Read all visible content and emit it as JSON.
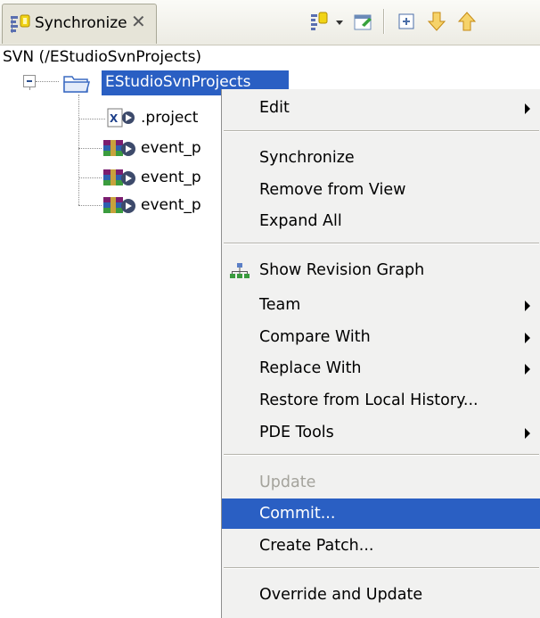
{
  "view": {
    "tab_label": "Synchronize",
    "close_glyph": "✕",
    "tab_icon": "synchronize-view-icon",
    "toolbar_icons": [
      "synchronize-dropdown-icon",
      "pin-icon",
      "expand-all-icon",
      "next-change-icon",
      "previous-change-icon"
    ]
  },
  "repository_path": "SVN (/EStudioSvnProjects)",
  "tree": {
    "root": {
      "label": "EStudioSvnProjects",
      "icon": "folder-icon"
    },
    "children": [
      {
        "label": ".project",
        "icon": "xml-file-outgoing-icon"
      },
      {
        "label": "event_p",
        "icon": "archive-outgoing-icon"
      },
      {
        "label": "event_p",
        "icon": "archive-outgoing-icon"
      },
      {
        "label": "event_p",
        "icon": "archive-outgoing-icon"
      }
    ]
  },
  "menu": {
    "items": [
      {
        "label": "Edit",
        "submenu": true
      },
      {
        "label": "Synchronize"
      },
      {
        "label": "Remove from View"
      },
      {
        "label": "Expand All"
      },
      {
        "label": "Show Revision Graph",
        "icon": "revision-graph-icon"
      },
      {
        "label": "Team",
        "submenu": true
      },
      {
        "label": "Compare With",
        "submenu": true
      },
      {
        "label": "Replace With",
        "submenu": true
      },
      {
        "label": "Restore from Local History..."
      },
      {
        "label": "PDE Tools",
        "submenu": true
      },
      {
        "label": "Update",
        "disabled": true
      },
      {
        "label": "Commit...",
        "selected": true
      },
      {
        "label": "Create Patch..."
      },
      {
        "label": "Override and Update"
      }
    ]
  },
  "colors": {
    "selection": "#2a5fc3",
    "menu_background": "#f1f1f0",
    "disabled_text": "#a4a39c"
  }
}
